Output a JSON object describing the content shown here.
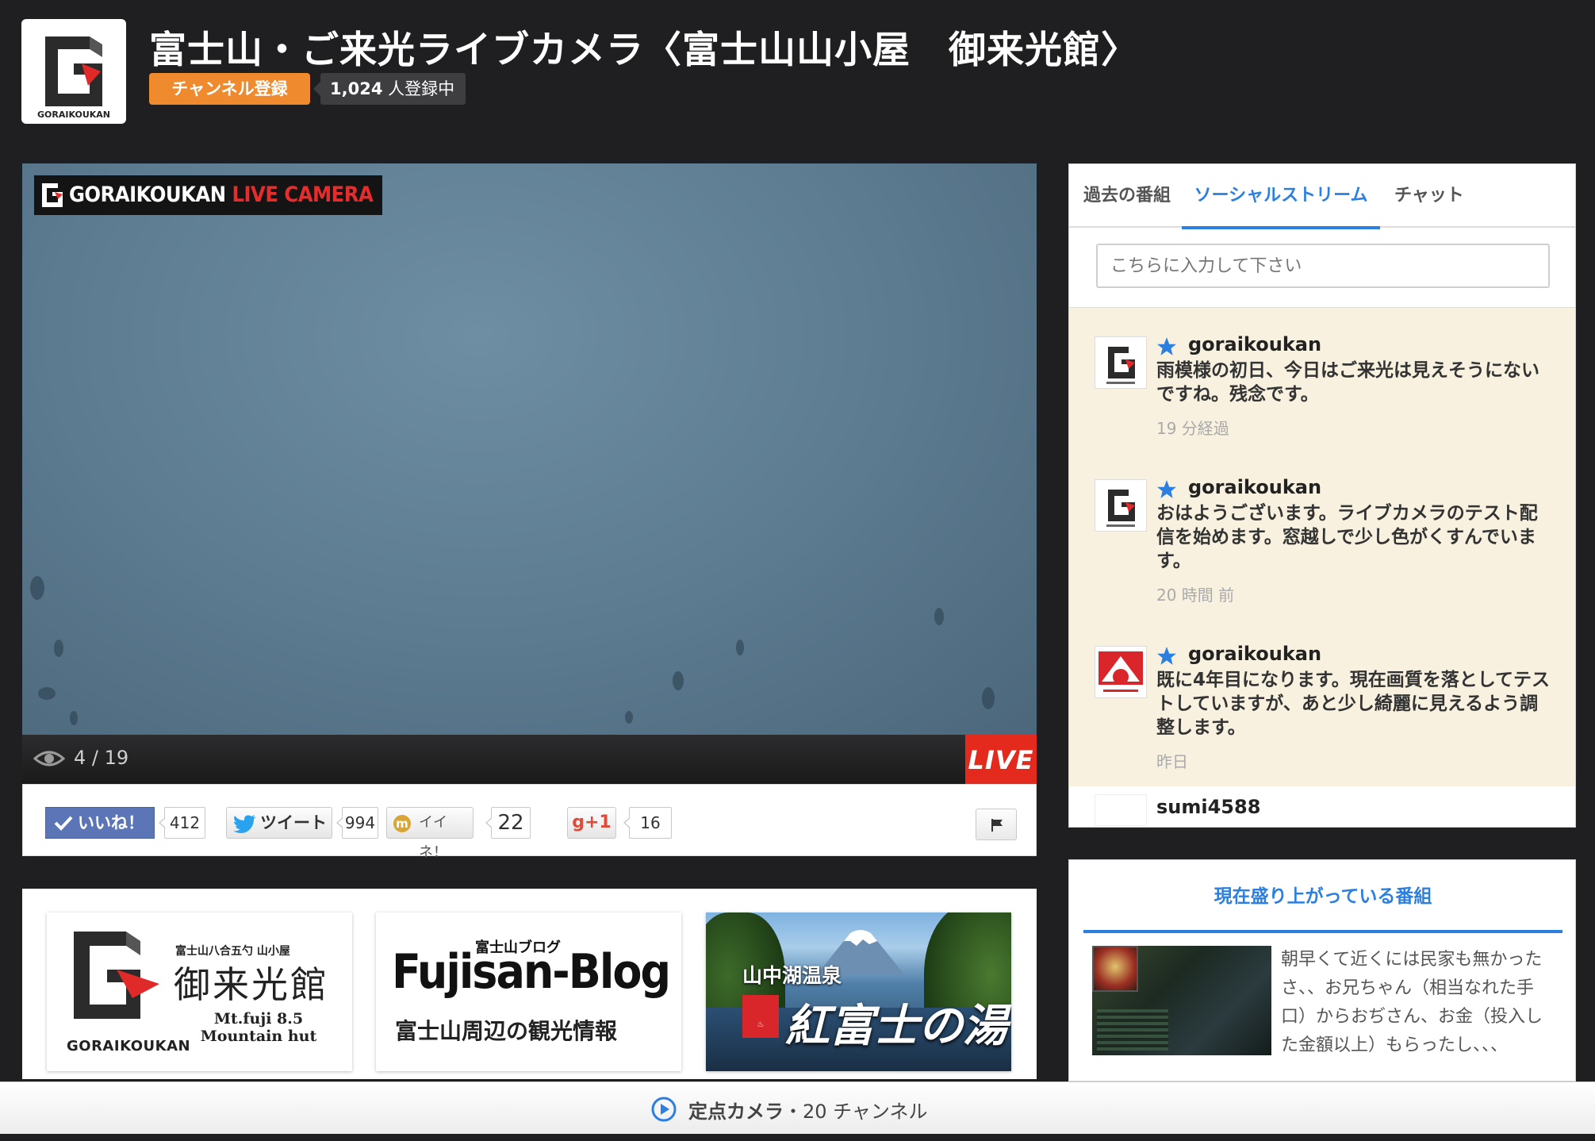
{
  "header": {
    "logo_text": "GORAIKOUKAN",
    "title": "富士山・ご来光ライブカメラ〈富士山山小屋　御来光館〉",
    "subscribe_label": "チャンネル登録",
    "subscriber_count": "1,024",
    "subscriber_suffix": "人登録中"
  },
  "player": {
    "badge_brand": "GORAIKOUKAN",
    "badge_live": "LIVE CAMERA",
    "viewer_count": "4 / 19",
    "live_label": "LIVE"
  },
  "share": {
    "like_label": "いいね！",
    "like_count": "412",
    "tweet_label": "ツイート",
    "tweet_count": "994",
    "mixi_icon": "m",
    "mixi_label": "イイネ！",
    "mixi_count": "22",
    "gplus_label": "g+1",
    "gplus_count": "16"
  },
  "banners": [
    {
      "sub": "富士山八合五勺 山小屋",
      "name": "御来光館",
      "en_line1": "Mt.fuji 8.5",
      "en_line2": "Mountain hut",
      "logo_text": "GORAIKOUKAN"
    },
    {
      "small": "富士山ブログ",
      "big": "Fujisan-Blog",
      "desc": "富士山周辺の観光情報"
    },
    {
      "title": "山中湖温泉",
      "name": "紅富士の湯"
    }
  ],
  "side": {
    "tabs": [
      "過去の番組",
      "ソーシャルストリーム",
      "チャット"
    ],
    "input_placeholder": "こちらに入力して下さい",
    "posts": [
      {
        "user": "goraikoukan",
        "text": "雨模様の初日、今日はご来光は見えそうにないですね。残念です。",
        "time": "19 分経過"
      },
      {
        "user": "goraikoukan",
        "text": "おはようございます。ライブカメラのテスト配信を始めます。窓越しで少し色がくすんでいます。",
        "time": "20 時間 前"
      },
      {
        "user": "goraikoukan",
        "text": "既に4年目になります。現在画質を落としてテストしていますが、あと少し綺麗に見えるよう調整します。",
        "time": "昨日"
      }
    ],
    "next_user": "sumi4588"
  },
  "trending": {
    "title": "現在盛り上がっている番組",
    "text": "朝早くて近くには民家も無かったさ、、お兄ちゃん（相当なれた手口）からおぢさん、お金（投入した金額以上）もらったし、、、"
  },
  "bottom": {
    "label": "定点カメラ",
    "separator": "・",
    "count": "20 チャンネル"
  },
  "colors": {
    "accent_blue": "#2b7fe0",
    "subscribe_orange": "#f08a2e",
    "live_red": "#e42a1c",
    "stream_bg": "#f8f1e0"
  }
}
